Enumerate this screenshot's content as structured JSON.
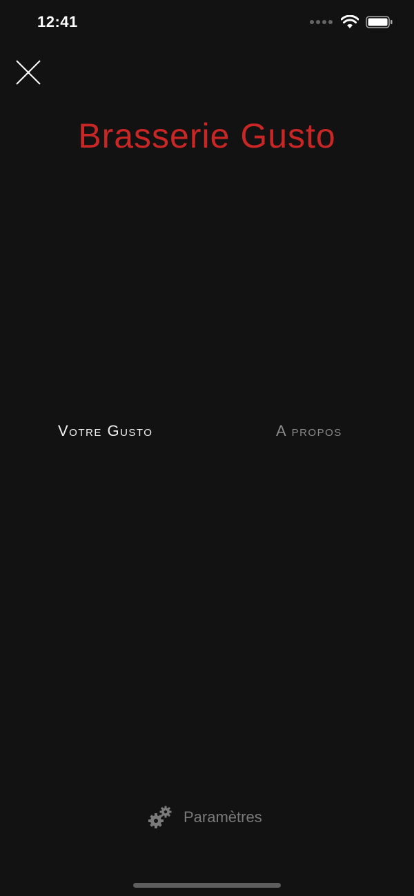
{
  "status_bar": {
    "time": "12:41"
  },
  "header": {
    "close_icon": "close-icon"
  },
  "brand": {
    "title": "Brasserie Gusto",
    "color": "#c92626"
  },
  "nav": {
    "items": [
      {
        "label": "Votre Gusto",
        "active": true
      },
      {
        "label": "A propos",
        "active": false
      }
    ]
  },
  "footer": {
    "settings_label": "Paramètres",
    "settings_icon": "gears-icon"
  }
}
